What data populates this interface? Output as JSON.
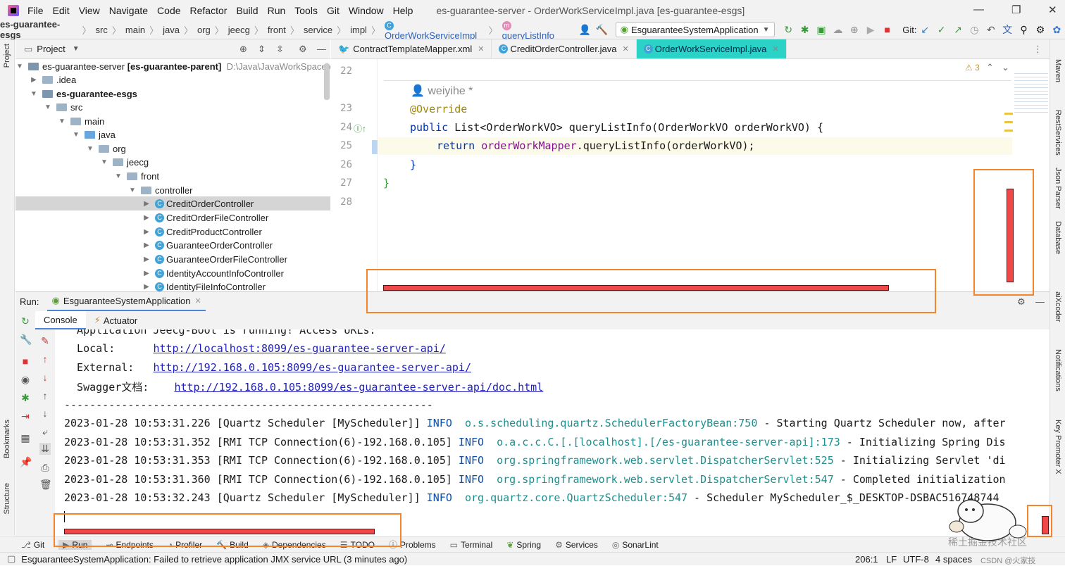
{
  "menu": {
    "items": [
      "File",
      "Edit",
      "View",
      "Navigate",
      "Code",
      "Refactor",
      "Build",
      "Run",
      "Tools",
      "Git",
      "Window",
      "Help"
    ],
    "title": "es-guarantee-server - OrderWorkServiceImpl.java [es-guarantee-esgs]"
  },
  "nav": {
    "crumbs": [
      "es-guarantee-esgs",
      "src",
      "main",
      "java",
      "org",
      "jeecg",
      "front",
      "service",
      "impl"
    ],
    "class": "OrderWorkServiceImpl",
    "method": "queryListInfo",
    "run_config": "EsguaranteeSystemApplication",
    "git_label": "Git:"
  },
  "project": {
    "title": "Project",
    "tree": [
      {
        "label": "es-guarantee-server",
        "extra": "[es-guarantee-parent]",
        "path": "D:\\Java\\JavaWorkSpace\\es"
      },
      {
        "label": ".idea"
      },
      {
        "label": "es-guarantee-esgs"
      },
      {
        "label": "src"
      },
      {
        "label": "main"
      },
      {
        "label": "java"
      },
      {
        "label": "org"
      },
      {
        "label": "jeecg"
      },
      {
        "label": "front"
      },
      {
        "label": "controller"
      },
      {
        "label": "CreditOrderController"
      },
      {
        "label": "CreditOrderFileController"
      },
      {
        "label": "CreditProductController"
      },
      {
        "label": "GuaranteeOrderController"
      },
      {
        "label": "GuaranteeOrderFileController"
      },
      {
        "label": "IdentityAccountInfoController"
      },
      {
        "label": "IdentityFileInfoController"
      }
    ]
  },
  "tabs": [
    "ContractTemplateMapper.xml",
    "CreditOrderController.java",
    "OrderWorkServiceImpl.java"
  ],
  "editor": {
    "author": "weiyihe *",
    "line_numbers": [
      "22",
      "23",
      "24",
      "25",
      "26",
      "27",
      "28"
    ],
    "warnings": "3",
    "code": {
      "l23": "@Override",
      "l24_kw": "public",
      "l24_rest": " List<OrderWorkVO> queryListInfo(OrderWorkVO orderWorkVO) {",
      "l25_kw": "return",
      "l25_field": "orderWorkMapper",
      "l25_rest": ".queryListInfo(orderWorkVO);",
      "l26": "}",
      "l27": "}"
    }
  },
  "run": {
    "label": "Run:",
    "app": "EsguaranteeSystemApplication",
    "tab_console": "Console",
    "tab_actuator": "Actuator",
    "console": {
      "l0": "  Application Jeecg-Boot is running! Access URLs:",
      "local_label": "  Local:      ",
      "local_url": "http://localhost:8099/es-guarantee-server-api/",
      "ext_label": "  External:   ",
      "ext_url": "http://192.168.0.105:8099/es-guarantee-server-api/",
      "sw_label": "  Swagger文档:    ",
      "sw_url": "http://192.168.0.105:8099/es-guarantee-server-api/doc.html",
      "dash": "----------------------------------------------------------",
      "logs": [
        {
          "ts": "2023-01-28 10:53:31.226 [Quartz Scheduler [MyScheduler]] ",
          "lvl": "INFO ",
          "cls": "o.s.scheduling.quartz.SchedulerFactoryBean:750",
          "msg": " - Starting Quartz Scheduler now, after"
        },
        {
          "ts": "2023-01-28 10:53:31.352 [RMI TCP Connection(6)-192.168.0.105] ",
          "lvl": "INFO ",
          "cls": "o.a.c.c.C.[.[localhost].[/es-guarantee-server-api]:173",
          "msg": " - Initializing Spring Dis"
        },
        {
          "ts": "2023-01-28 10:53:31.353 [RMI TCP Connection(6)-192.168.0.105] ",
          "lvl": "INFO ",
          "cls": "org.springframework.web.servlet.DispatcherServlet:525",
          "msg": " - Initializing Servlet 'di"
        },
        {
          "ts": "2023-01-28 10:53:31.360 [RMI TCP Connection(6)-192.168.0.105] ",
          "lvl": "INFO ",
          "cls": "org.springframework.web.servlet.DispatcherServlet:547",
          "msg": " - Completed initialization"
        },
        {
          "ts": "2023-01-28 10:53:32.243 [Quartz Scheduler [MyScheduler]] ",
          "lvl": "INFO ",
          "cls": "org.quartz.core.QuartzScheduler:547",
          "msg": " - Scheduler MyScheduler_$_DESKTOP-DSBAC516748744"
        }
      ]
    }
  },
  "bottom": [
    "Git",
    "Run",
    "Endpoints",
    "Profiler",
    "Build",
    "Dependencies",
    "TODO",
    "Problems",
    "Terminal",
    "Spring",
    "Services",
    "SonarLint"
  ],
  "status": {
    "msg": "EsguaranteeSystemApplication: Failed to retrieve application JMX service URL (3 minutes ago)",
    "pos": "206:1",
    "sep": "LF",
    "enc": "UTF-8",
    "indent": "4 spaces",
    "watermark": "稀土掘金技术社区",
    "csdn": "CSDN @火家技"
  },
  "left_tools": [
    "Project",
    "Bookmarks",
    "Structure"
  ],
  "right_tools": [
    "Maven",
    "RestServices",
    "Json Parser",
    "Database",
    "aiXcoder",
    "Notifications",
    "Key Promoter X"
  ]
}
